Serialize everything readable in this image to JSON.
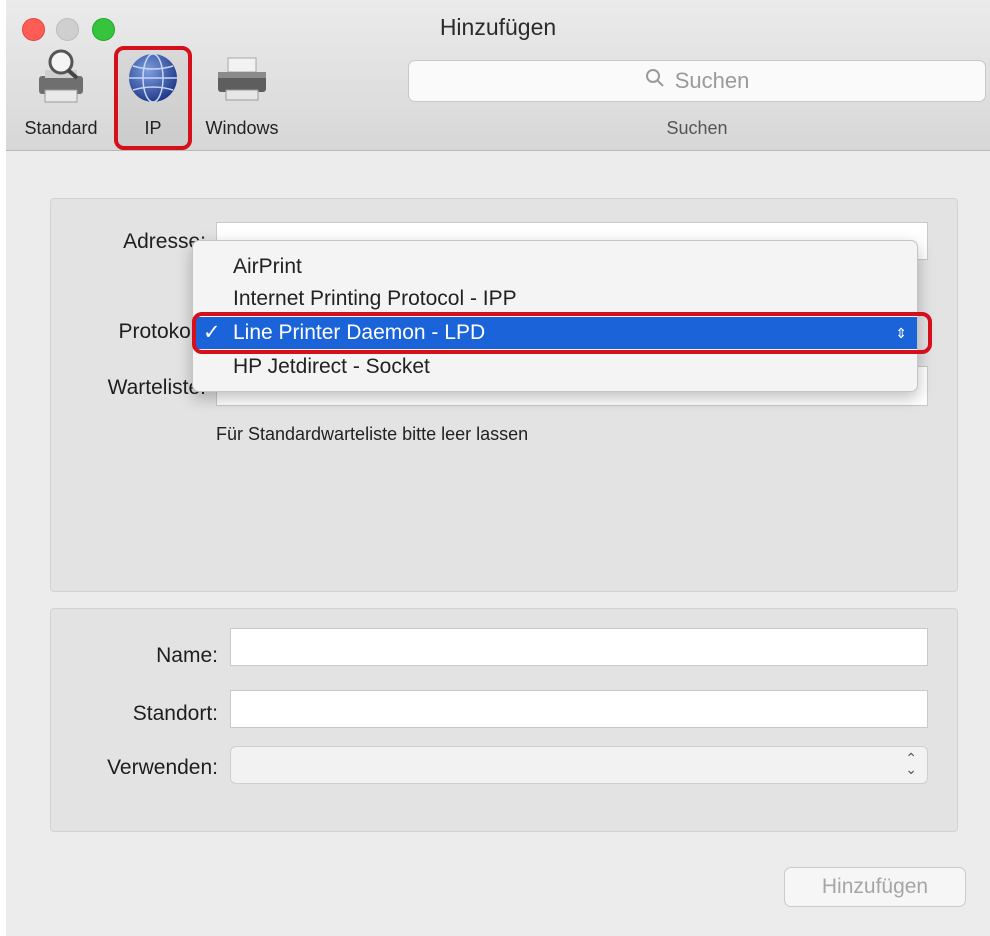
{
  "window": {
    "title": "Hinzufügen"
  },
  "toolbar": {
    "items": [
      {
        "label": "Standard",
        "icon": "printer-magnifier-icon"
      },
      {
        "label": "IP",
        "icon": "globe-icon"
      },
      {
        "label": "Windows",
        "icon": "windows-printer-icon"
      }
    ],
    "selected": "IP",
    "search": {
      "placeholder": "Suchen",
      "label": "Suchen"
    }
  },
  "ip_form": {
    "address_label": "Adresse:",
    "address_value": "",
    "protocol_label": "Protokoll:",
    "protocol_options": [
      "AirPrint",
      "Internet Printing Protocol - IPP",
      "Line Printer Daemon - LPD",
      "HP Jetdirect - Socket"
    ],
    "protocol_selected": "Line Printer Daemon - LPD",
    "queue_label": "Warteliste:",
    "queue_value": "",
    "queue_hint": "Für Standardwarteliste bitte leer lassen"
  },
  "printer_info": {
    "name_label": "Name:",
    "name_value": "",
    "location_label": "Standort:",
    "location_value": "",
    "use_label": "Verwenden:",
    "use_value": ""
  },
  "actions": {
    "add_label": "Hinzufügen"
  },
  "colors": {
    "selection_blue": "#1b63d9",
    "annotation_red": "#d50f1b",
    "close_red": "#fd5d55",
    "zoom_green": "#35c43c"
  }
}
